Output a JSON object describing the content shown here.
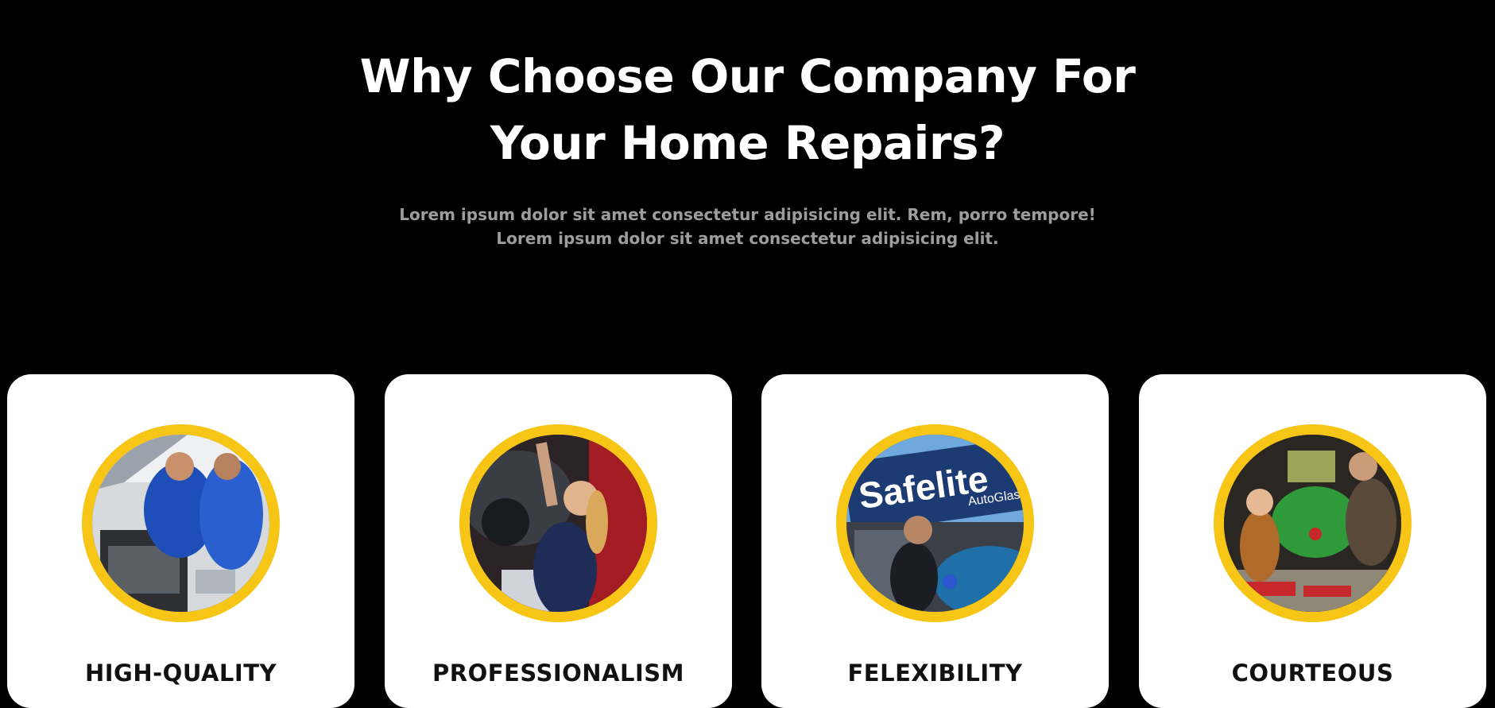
{
  "hero": {
    "title_line1": "Why Choose Our Company For",
    "title_line2": "Your Home Repairs?",
    "subtitle_line1": "Lorem ipsum dolor sit amet consectetur adipisicing elit. Rem, porro tempore!",
    "subtitle_line2": "Lorem ipsum dolor sit amet consectetur adipisicing elit."
  },
  "colors": {
    "background": "#000000",
    "card": "#ffffff",
    "accent_ring": "#f6c515",
    "subtitle": "#9d9d9d"
  },
  "cards": [
    {
      "title": "HIGH-QUALITY",
      "image": "mechanics-working-on-car-engine"
    },
    {
      "title": "PROFESSIONALISM",
      "image": "technician-working-under-car"
    },
    {
      "title": "FELEXIBILITY",
      "image": "safelite-autoglass-technician"
    },
    {
      "title": "COURTEOUS",
      "image": "father-daughter-repairing-mower"
    }
  ],
  "image_text": {
    "sign_brand": "Safelite",
    "sign_sub": "AutoGlass"
  }
}
